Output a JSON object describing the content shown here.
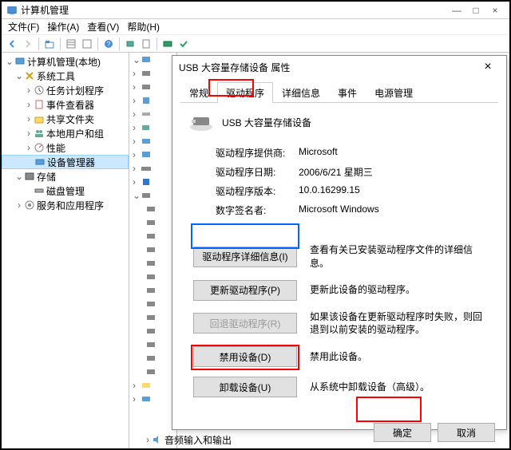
{
  "window": {
    "title": "计算机管理",
    "close": "×",
    "min": "—",
    "max": "□"
  },
  "menu": {
    "file": "文件(F)",
    "action": "操作(A)",
    "view": "查看(V)",
    "help": "帮助(H)"
  },
  "tree": {
    "root": "计算机管理(本地)",
    "sys_tools": "系统工具",
    "task_sched": "任务计划程序",
    "event_viewer": "事件查看器",
    "shared": "共享文件夹",
    "local_users": "本地用户和组",
    "perf": "性能",
    "devmgr": "设备管理器",
    "storage": "存储",
    "diskmgr": "磁盘管理",
    "services": "服务和应用程序"
  },
  "bottom_item": "音频输入和输出",
  "expanders": {
    "expanded": "⌄",
    "collapsed": "›"
  },
  "dialog": {
    "title": "USB 大容量存储设备 属性",
    "close": "×",
    "tabs": {
      "general": "常规",
      "driver": "驱动程序",
      "details": "详细信息",
      "events": "事件",
      "power": "电源管理"
    },
    "device_name": "USB 大容量存储设备",
    "info": {
      "provider_lbl": "驱动程序提供商:",
      "provider_val": "Microsoft",
      "date_lbl": "驱动程序日期:",
      "date_val": "2006/6/21 星期三",
      "version_lbl": "驱动程序版本:",
      "version_val": "10.0.16299.15",
      "signer_lbl": "数字签名者:",
      "signer_val": "Microsoft Windows"
    },
    "actions": {
      "details_btn": "驱动程序详细信息(I)",
      "details_desc": "查看有关已安装驱动程序文件的详细信息。",
      "update_btn": "更新驱动程序(P)",
      "update_desc": "更新此设备的驱动程序。",
      "rollback_btn": "回退驱动程序(R)",
      "rollback_desc": "如果该设备在更新驱动程序时失败，则回退到以前安装的驱动程序。",
      "disable_btn": "禁用设备(D)",
      "disable_desc": "禁用此设备。",
      "uninstall_btn": "卸载设备(U)",
      "uninstall_desc": "从系统中卸载设备（高级）。"
    },
    "ok": "确定",
    "cancel": "取消"
  }
}
